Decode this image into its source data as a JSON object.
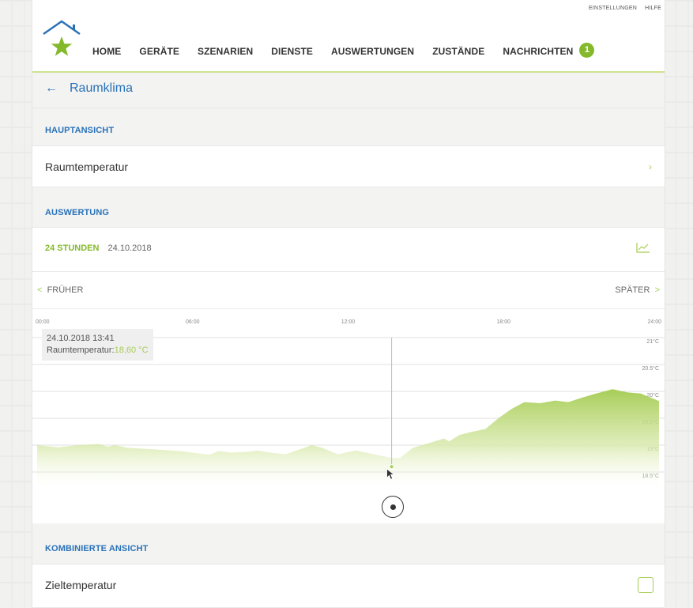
{
  "top_links": {
    "settings": "EINSTELLUNGEN",
    "help": "HILFE"
  },
  "nav": {
    "items": [
      "HOME",
      "GERÄTE",
      "SZENARIEN",
      "DIENSTE",
      "AUSWERTUNGEN",
      "ZUSTÄNDE",
      "NACHRICHTEN"
    ],
    "messages_badge": "1"
  },
  "page": {
    "title": "Raumklima",
    "back_icon": "←"
  },
  "sections": {
    "main_view": "HAUPTANSICHT",
    "room_temperature": "Raumtemperatur",
    "evaluation": "AUSWERTUNG",
    "combined_view": "KOMBINIERTE ANSICHT",
    "target_temperature": "Zieltemperatur"
  },
  "period": {
    "range": "24 STUNDEN",
    "date": "24.10.2018"
  },
  "chart_nav": {
    "earlier": "FRÜHER",
    "later": "SPÄTER",
    "earlier_icon": "<",
    "later_icon": ">"
  },
  "tooltip": {
    "timestamp": "24.10.2018 13:41",
    "label": "Raumtemperatur:",
    "value": "18,60 °C"
  },
  "colors": {
    "accent": "#84b92c",
    "link": "#2a72b8",
    "area_fill": "#a7cd57"
  },
  "chart_data": {
    "type": "area",
    "x_tick_labels": [
      "00:00",
      "06:00",
      "12:00",
      "18:00",
      "24:00"
    ],
    "y_tick_labels": [
      "21°C",
      "20.5°C",
      "20°C",
      "19.5°C",
      "19°C",
      "18.5°C"
    ],
    "y_ticks": [
      21,
      20.5,
      20,
      19.5,
      19,
      18.5
    ],
    "xlim": [
      0,
      24
    ],
    "ylim": [
      18.5,
      21
    ],
    "series": [
      {
        "x": [
          0,
          0.8,
          1.6,
          2.4,
          2.7,
          3.0,
          3.5,
          4.5,
          5.5,
          6.5,
          6.7,
          7.0,
          7.5,
          8.2,
          8.5,
          9.0,
          9.6,
          10.0,
          10.6,
          11.0,
          11.6,
          12.3,
          13.0,
          13.68,
          14.0,
          14.5,
          15.2,
          15.7,
          15.9,
          16.3,
          16.8,
          17.3,
          17.8,
          18.3,
          18.8,
          19.4,
          20.0,
          20.5,
          21.0,
          21.5,
          22.2,
          22.8,
          23.3,
          24.0
        ],
        "y": [
          19.0,
          18.96,
          19.0,
          19.02,
          18.97,
          19.0,
          18.95,
          18.92,
          18.89,
          18.83,
          18.83,
          18.89,
          18.86,
          18.88,
          18.9,
          18.86,
          18.83,
          18.9,
          19.0,
          18.95,
          18.83,
          18.9,
          18.83,
          18.76,
          18.76,
          18.95,
          19.05,
          19.12,
          19.07,
          19.19,
          19.25,
          19.3,
          19.5,
          19.67,
          19.8,
          19.78,
          19.83,
          19.8,
          19.88,
          19.95,
          20.04,
          19.98,
          19.96,
          19.82
        ]
      }
    ],
    "cursor": {
      "x": 13.68,
      "y": 18.6
    }
  }
}
